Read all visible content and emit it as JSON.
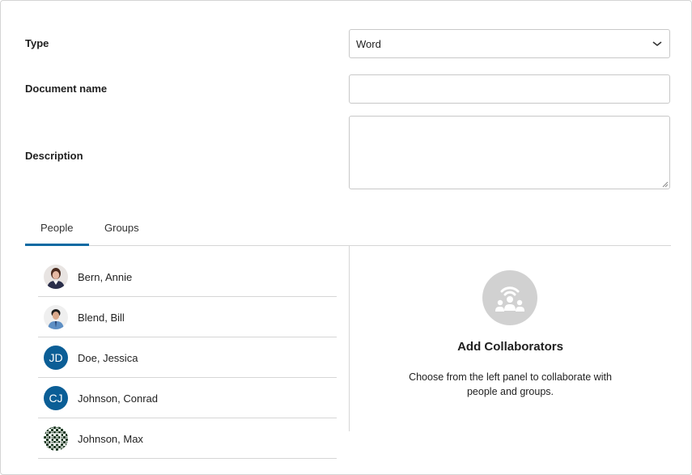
{
  "form": {
    "type_label": "Type",
    "type_value": "Word",
    "name_label": "Document name",
    "name_value": "",
    "description_label": "Description",
    "description_value": ""
  },
  "tabs": [
    {
      "label": "People",
      "selected": true
    },
    {
      "label": "Groups",
      "selected": false
    }
  ],
  "people": [
    {
      "name": "Bern, Annie",
      "avatar": "photo"
    },
    {
      "name": "Blend, Bill",
      "avatar": "photo"
    },
    {
      "name": "Doe, Jessica",
      "initials": "JD"
    },
    {
      "name": "Johnson, Conrad",
      "initials": "CJ"
    },
    {
      "name": "Johnson, Max",
      "avatar": "pattern"
    }
  ],
  "collaborators": {
    "icon": "collaborators-icon",
    "title": "Add Collaborators",
    "text": "Choose from the left panel to collaborate with people and groups."
  },
  "colors": {
    "accent": "#0b6aa2",
    "initials_avatar": "#0b5e96",
    "collab_icon_bg": "#d1d1d1"
  }
}
